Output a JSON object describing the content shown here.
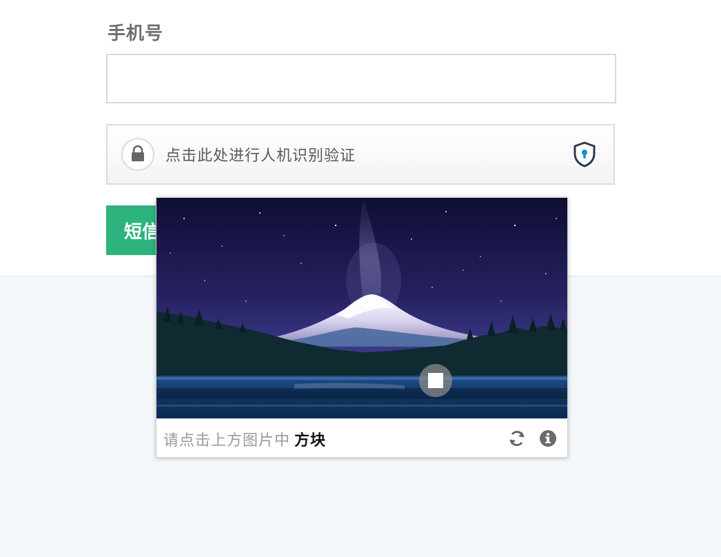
{
  "form": {
    "phone_label": "手机号",
    "phone_value": "",
    "captcha_trigger_text": "点击此处进行人机识别验证",
    "sms_button_label": "短信"
  },
  "popup": {
    "instruction_prefix": "请点击上方图片中",
    "instruction_target": "方块"
  },
  "icons": {
    "lock": "lock-icon",
    "shield": "shield-keyhole-icon",
    "refresh": "refresh-icon",
    "info": "info-icon"
  },
  "colors": {
    "primary_green": "#2db37d",
    "shield_blue": "#1e8ad6",
    "background_bottom": "#f4f7fa",
    "night_sky": "#262262"
  }
}
